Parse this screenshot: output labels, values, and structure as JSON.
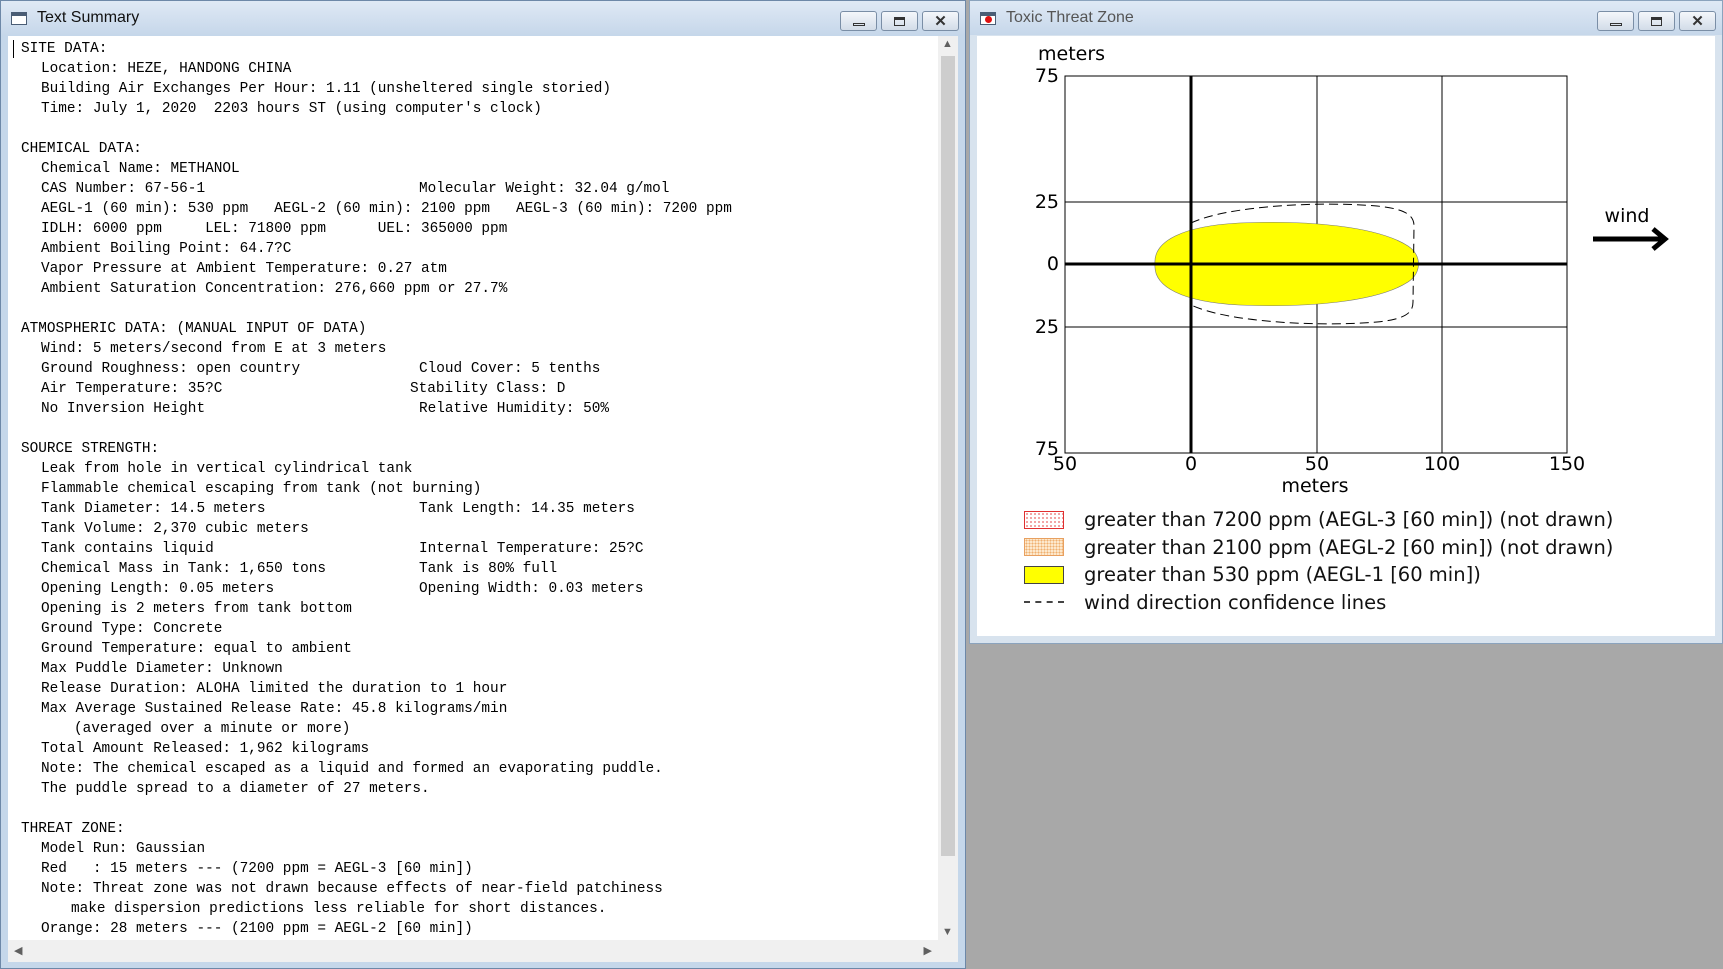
{
  "text_window": {
    "title": "Text Summary",
    "lines": [
      {
        "t": "SITE DATA:",
        "c": 0
      },
      {
        "t": "Location: HEZE, HANDONG CHINA",
        "c": 1
      },
      {
        "t": "Building Air Exchanges Per Hour: 1.11 (unsheltered single storied)",
        "c": 1
      },
      {
        "t": "Time: July 1, 2020  2203 hours ST (using computer's clock)",
        "c": 1
      },
      {
        "t": "",
        "c": 0
      },
      {
        "t": "CHEMICAL DATA:",
        "c": 0
      },
      {
        "t": "Chemical Name: METHANOL",
        "c": 1
      },
      {
        "t": "CAS Number: 67-56-1",
        "c": 1,
        "r": "Molecular Weight: 32.04 g/mol"
      },
      {
        "t": "AEGL-1 (60 min): 530 ppm   AEGL-2 (60 min): 2100 ppm   AEGL-3 (60 min): 7200 ppm",
        "c": 1
      },
      {
        "t": "IDLH: 6000 ppm     LEL: 71800 ppm      UEL: 365000 ppm",
        "c": 1
      },
      {
        "t": "Ambient Boiling Point: 64.7?C",
        "c": 1
      },
      {
        "t": "Vapor Pressure at Ambient Temperature: 0.27 atm",
        "c": 1
      },
      {
        "t": "Ambient Saturation Concentration: 276,660 ppm or 27.7%",
        "c": 1
      },
      {
        "t": "",
        "c": 0
      },
      {
        "t": "ATMOSPHERIC DATA: (MANUAL INPUT OF DATA)",
        "c": 0
      },
      {
        "t": "Wind: 5 meters/second from E at 3 meters",
        "c": 1
      },
      {
        "t": "Ground Roughness: open country",
        "c": 1,
        "r": "Cloud Cover: 5 tenths"
      },
      {
        "t": "Air Temperature: 35?C",
        "c": 1,
        "r": "Stability Class: D",
        "ro": -9
      },
      {
        "t": "No Inversion Height",
        "c": 1,
        "r": "Relative Humidity: 50%"
      },
      {
        "t": "",
        "c": 0
      },
      {
        "t": "SOURCE STRENGTH:",
        "c": 0
      },
      {
        "t": "Leak from hole in vertical cylindrical tank",
        "c": 1
      },
      {
        "t": "Flammable chemical escaping from tank (not burning)",
        "c": 1
      },
      {
        "t": "Tank Diameter: 14.5 meters",
        "c": 1,
        "r": "Tank Length: 14.35 meters"
      },
      {
        "t": "Tank Volume: 2,370 cubic meters",
        "c": 1
      },
      {
        "t": "Tank contains liquid",
        "c": 1,
        "r": "Internal Temperature: 25?C"
      },
      {
        "t": "Chemical Mass in Tank: 1,650 tons",
        "c": 1,
        "r": "Tank is 80% full"
      },
      {
        "t": "Opening Length: 0.05 meters",
        "c": 1,
        "r": "Opening Width: 0.03 meters"
      },
      {
        "t": "Opening is 2 meters from tank bottom",
        "c": 1
      },
      {
        "t": "Ground Type: Concrete",
        "c": 1
      },
      {
        "t": "Ground Temperature: equal to ambient",
        "c": 1
      },
      {
        "t": "Max Puddle Diameter: Unknown",
        "c": 1
      },
      {
        "t": "Release Duration: ALOHA limited the duration to 1 hour",
        "c": 1
      },
      {
        "t": "Max Average Sustained Release Rate: 45.8 kilograms/min",
        "c": 1
      },
      {
        "t": "(averaged over a minute or more)",
        "c": 2
      },
      {
        "t": "Total Amount Released: 1,962 kilograms",
        "c": 1
      },
      {
        "t": "Note: The chemical escaped as a liquid and formed an evaporating puddle.",
        "c": 1
      },
      {
        "t": "The puddle spread to a diameter of 27 meters.",
        "c": 1
      },
      {
        "t": "",
        "c": 0
      },
      {
        "t": "THREAT ZONE:",
        "c": 0
      },
      {
        "t": "Model Run: Gaussian",
        "c": 1
      },
      {
        "t": "Red   : 15 meters --- (7200 ppm = AEGL-3 [60 min])",
        "c": 1
      },
      {
        "t": "Note: Threat zone was not drawn because effects of near-field patchiness",
        "c": 1
      },
      {
        "t": "make dispersion predictions less reliable for short distances.",
        "c": 3
      },
      {
        "t": "Orange: 28 meters --- (2100 ppm = AEGL-2 [60 min])",
        "c": 1
      }
    ]
  },
  "zone_window": {
    "title": "Toxic Threat Zone",
    "plot": {
      "y_unit_label": "meters",
      "x_unit_label": "meters",
      "y_ticks": [
        "75",
        "25",
        "0",
        "25",
        "75"
      ],
      "x_ticks": [
        "50",
        "0",
        "50",
        "100",
        "150"
      ],
      "wind_label": "wind"
    },
    "legend": [
      {
        "label": "greater than 7200 ppm (AEGL-3 [60 min]) (not drawn)",
        "swatch": "red-dotted"
      },
      {
        "label": "greater than 2100 ppm (AEGL-2 [60 min]) (not drawn)",
        "swatch": "orange-dotted"
      },
      {
        "label": "greater than 530 ppm (AEGL-1 [60 min])",
        "swatch": "yellow"
      },
      {
        "label": "wind direction confidence lines",
        "swatch": "dashed"
      }
    ],
    "colors": {
      "aegl1_fill": "#ffff00",
      "grid": "#000000"
    }
  }
}
